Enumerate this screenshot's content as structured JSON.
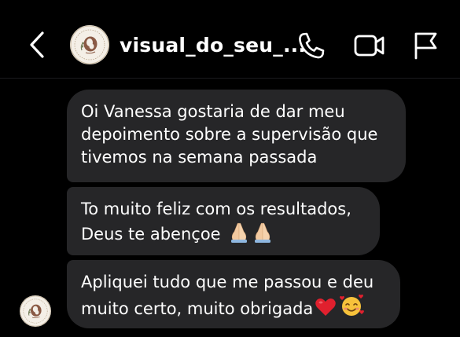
{
  "header": {
    "title": "visual_do_seu_...",
    "icons": {
      "back": "chevron-left-icon",
      "call": "phone-icon",
      "video": "video-camera-icon",
      "flag": "flag-icon"
    }
  },
  "messages": [
    {
      "lines": [
        "Oi Vanessa gostaria de dar meu",
        "depoimento sobre a supervisão que",
        "tivemos na semana passada"
      ]
    },
    {
      "lines": [
        "To muito feliz com os resultados,",
        "Deus te abençoe"
      ],
      "emoji": "praying-hands-emoji x2"
    },
    {
      "lines": [
        "Apliquei tudo que me passou e deu",
        "muito certo, muito obrigada"
      ],
      "emoji": "red-heart-emoji, smiling-face-with-hearts-emoji"
    }
  ],
  "colors": {
    "background": "#000000",
    "bubble": "#262628",
    "text": "#ffffff",
    "heart": "#e0202e",
    "emoji_face": "#f7c23b",
    "emoji_hands": "#f2c9a0"
  }
}
